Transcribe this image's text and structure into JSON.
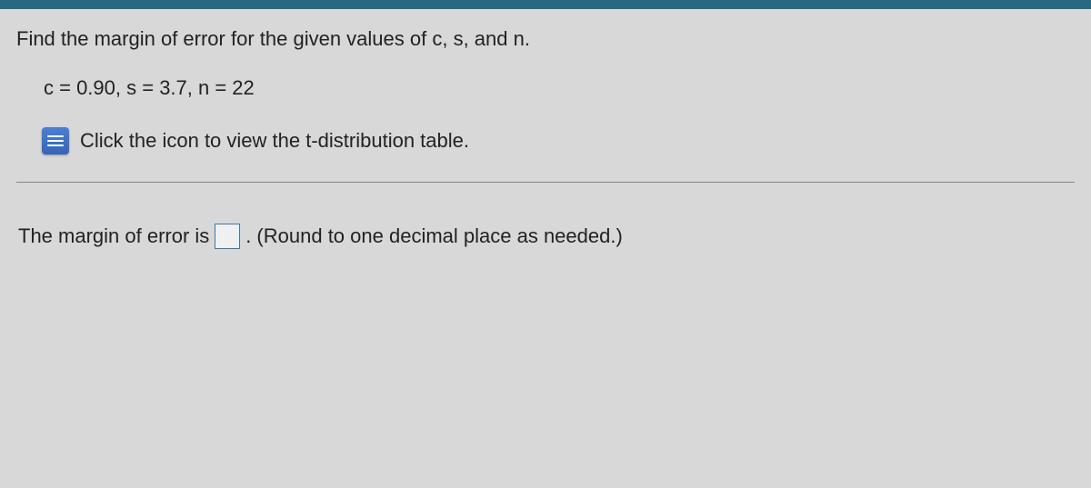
{
  "question": {
    "prompt": "Find the margin of error for the given values of c, s, and n.",
    "values": "c = 0.90, s = 3.7, n = 22",
    "table_link_text": "Click the icon to view the t-distribution table."
  },
  "answer": {
    "label_before": "The margin of error is",
    "input_value": "",
    "period": ".",
    "rounding_hint": "(Round to one decimal place as needed.)"
  }
}
